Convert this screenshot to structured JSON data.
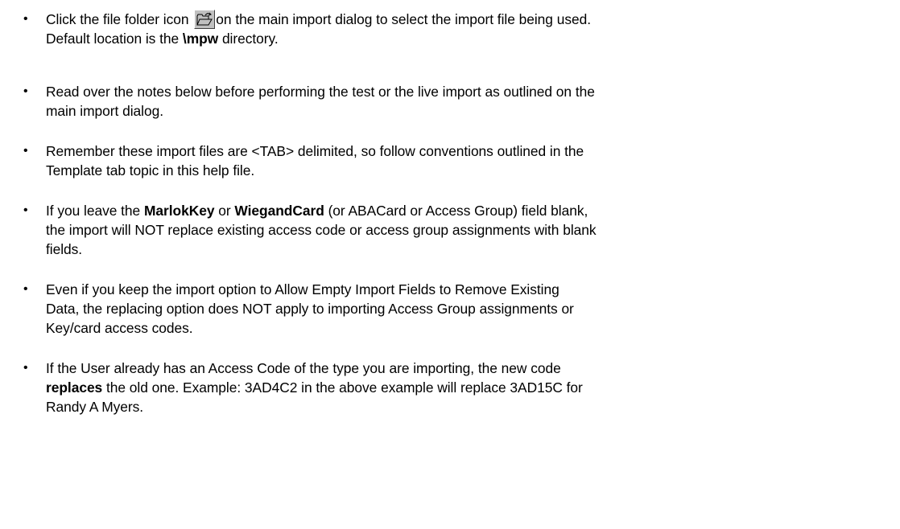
{
  "bullet_symbol": "•",
  "items": [
    {
      "before_icon": "Click the file folder icon ",
      "icon": "open-folder-icon",
      "after_icon": "on the main import dialog to select the import file being used.",
      "line2_before_bold": "Default location is the ",
      "line2_bold": "\\mpw",
      "line2_after_bold": " directory."
    },
    {
      "line1": "Read over the notes below before performing the test or the live import as outlined on the",
      "line2": "main import dialog."
    },
    {
      "line1": "Remember these import files are <TAB> delimited, so follow conventions outlined in the",
      "line2": "Template tab topic in this help file."
    },
    {
      "l1_a": "If you leave the ",
      "l1_bold1": "MarlokKey",
      "l1_b": " or ",
      "l1_bold2": "WiegandCard",
      "l1_c": " (or ABACard or Access Group) field blank,",
      "line2": "the import will NOT replace existing access code or access group assignments with blank",
      "line3": "fields."
    },
    {
      "line1": "Even if you keep the import option to Allow Empty Import Fields to Remove Existing",
      "line2": "Data, the replacing option does NOT apply to importing Access Group assignments or",
      "line3": "Key/card access codes."
    },
    {
      "line1": "If the User already has an Access Code of the type you are importing, the new code",
      "l2_bold": "replaces",
      "l2_rest": " the old one. Example: 3AD4C2 in the above example will replace 3AD15C for",
      "line3": "Randy A Myers."
    }
  ]
}
